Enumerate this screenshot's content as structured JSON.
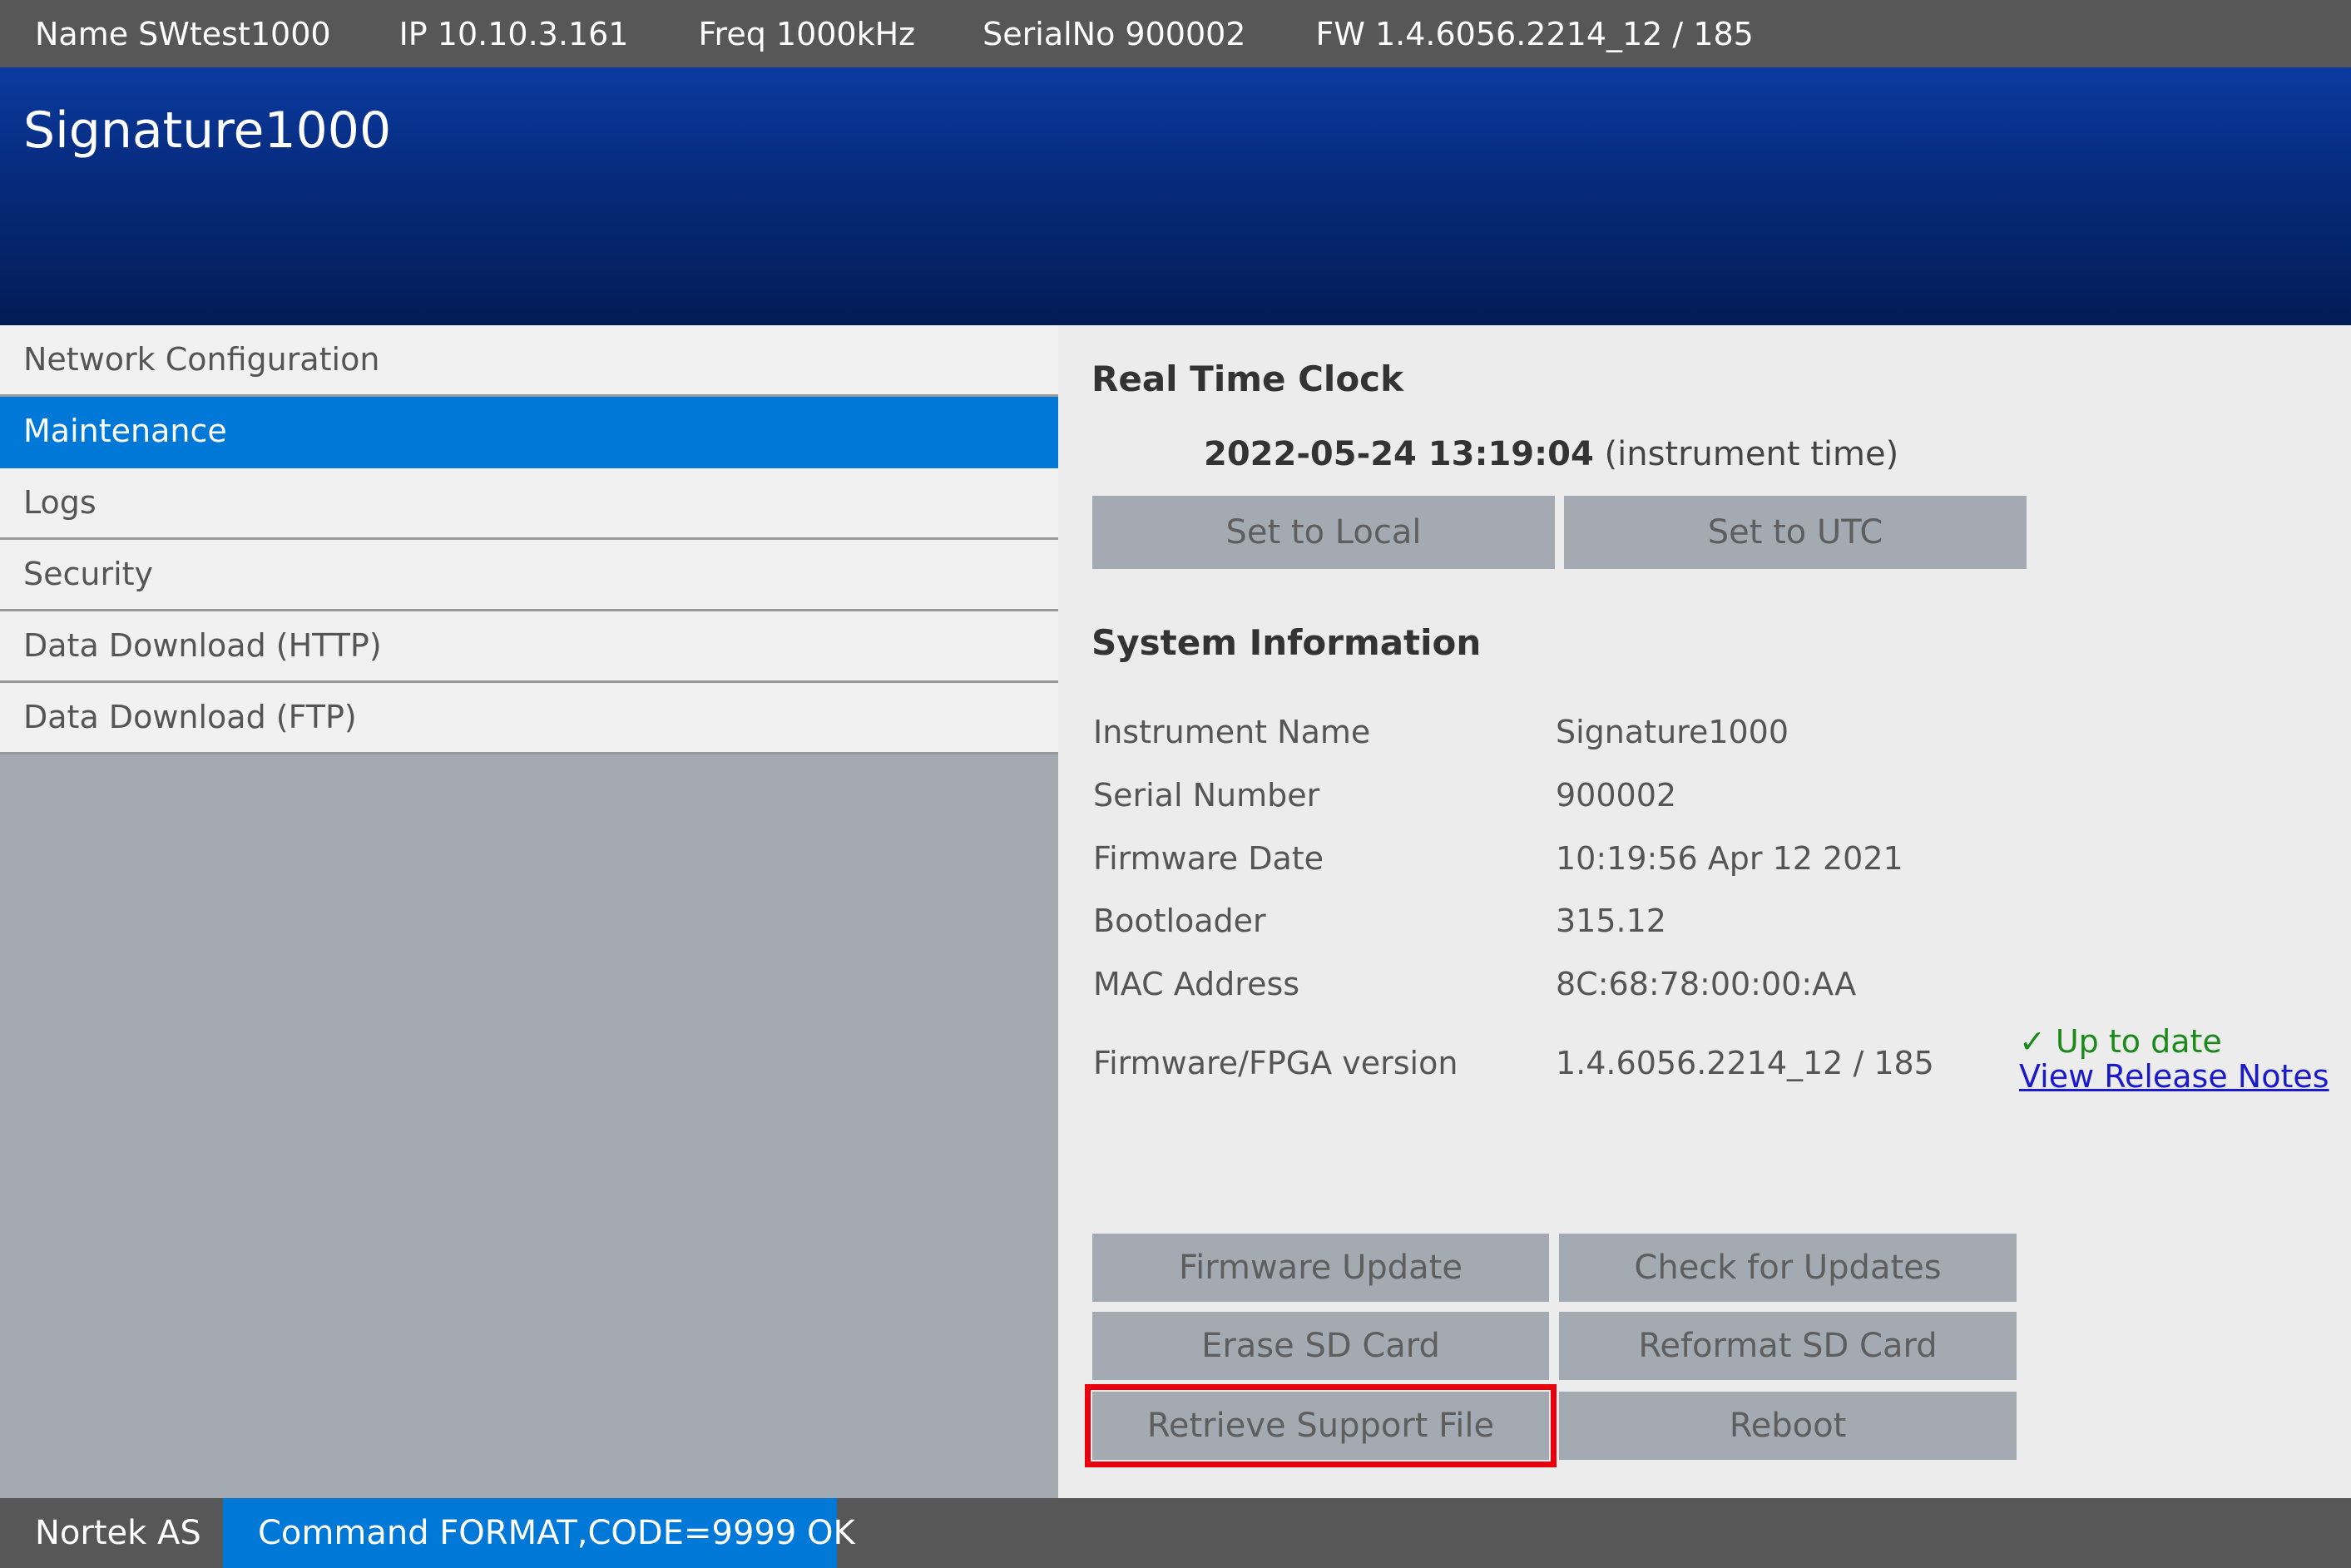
{
  "topbar": {
    "name": "Name SWtest1000",
    "ip": "IP 10.10.3.161",
    "freq": "Freq 1000kHz",
    "serial": "SerialNo 900002",
    "fw": "FW 1.4.6056.2214_12 / 185"
  },
  "header": {
    "title": "Signature1000"
  },
  "sidebar": {
    "items": [
      {
        "label": "Network Configuration"
      },
      {
        "label": "Maintenance",
        "active": true
      },
      {
        "label": "Logs"
      },
      {
        "label": "Security"
      },
      {
        "label": "Data Download (HTTP)"
      },
      {
        "label": "Data Download (FTP)"
      }
    ]
  },
  "rtc": {
    "title": "Real Time Clock",
    "datetime": "2022-05-24 13:19:04",
    "suffix": "(instrument time)",
    "set_local_label": "Set to Local",
    "set_utc_label": "Set to UTC"
  },
  "sysinfo": {
    "title": "System Information",
    "rows": [
      {
        "label": "Instrument Name",
        "value": "Signature1000"
      },
      {
        "label": "Serial Number",
        "value": "900002"
      },
      {
        "label": "Firmware Date",
        "value": "10:19:56 Apr 12 2021"
      },
      {
        "label": "Bootloader",
        "value": "315.12"
      },
      {
        "label": "MAC Address",
        "value": "8C:68:78:00:00:AA"
      },
      {
        "label": "Firmware/FPGA version",
        "value": "1.4.6056.2214_12 / 185"
      }
    ],
    "update_status": "Up to date",
    "release_notes_link": "View Release Notes"
  },
  "actions": {
    "firmware_update": "Firmware Update",
    "check_updates": "Check for Updates",
    "erase_sd": "Erase SD Card",
    "reformat_sd": "Reformat SD Card",
    "retrieve_support": "Retrieve Support File",
    "reboot": "Reboot"
  },
  "footer": {
    "company": "Nortek AS",
    "status": "Command FORMAT,CODE=9999 OK"
  },
  "colors": {
    "accent": "#0078d7",
    "highlight": "#e8000d",
    "ok": "#1b8a1b"
  }
}
